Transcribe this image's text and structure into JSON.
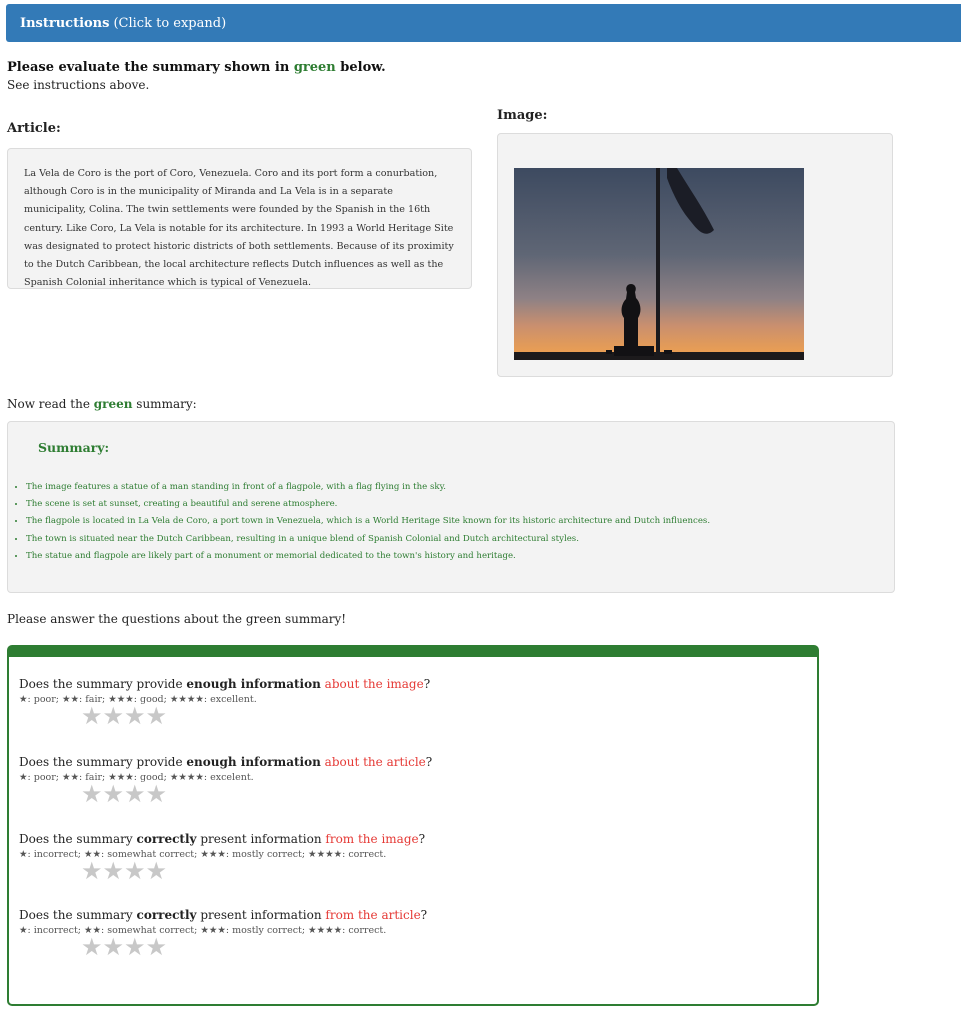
{
  "instructions_bar": {
    "title": "Instructions",
    "hint": "(Click to expand)"
  },
  "heading": {
    "prefix": "Please evaluate the summary shown in ",
    "green_word": "green",
    "suffix": " below."
  },
  "subheading": "See instructions above.",
  "article": {
    "label": "Article:",
    "text": "La Vela de Coro is the port of Coro, Venezuela. Coro and its port form a conurbation, although Coro is in the municipality of Miranda and La Vela is in a separate municipality, Colina. The twin settlements were founded by the Spanish in the 16th century. Like Coro, La Vela is notable for its architecture. In 1993 a World Heritage Site was designated to protect historic districts of both settlements. Because of its proximity to the Dutch Caribbean, the local architecture reflects Dutch influences as well as the Spanish Colonial inheritance which is typical of Venezuela."
  },
  "image_panel": {
    "label": "Image:"
  },
  "read_line": {
    "prefix": "Now read the ",
    "green_word": "green",
    "suffix": " summary:"
  },
  "summary": {
    "title": "Summary:",
    "items": [
      "The image features a statue of a man standing in front of a flagpole, with a flag flying in the sky.",
      "The scene is set at sunset, creating a beautiful and serene atmosphere.",
      "The flagpole is located in La Vela de Coro, a port town in Venezuela, which is a World Heritage Site known for its historic architecture and Dutch influences.",
      "The town is situated near the Dutch Caribbean, resulting in a unique blend of Spanish Colonial and Dutch architectural styles.",
      "The statue and flagpole are likely part of a monument or memorial dedicated to the town's history and heritage."
    ]
  },
  "answer_prompt": "Please answer the questions about the green summary!",
  "questions": [
    {
      "pre": "Does the summary provide ",
      "bold": "enough information",
      "mid": " ",
      "red": "about the image",
      "post": "?",
      "scale": "★: poor; ★★: fair; ★★★: good; ★★★★: excellent.",
      "star_count": 4
    },
    {
      "pre": "Does the summary provide ",
      "bold": "enough information",
      "mid": " ",
      "red": "about the article",
      "post": "?",
      "scale": "★: poor; ★★: fair; ★★★: good; ★★★★: excelent.",
      "star_count": 4
    },
    {
      "pre": "Does the summary ",
      "bold": "correctly",
      "mid": " present information ",
      "red": "from the image",
      "post": "?",
      "scale": "★: incorrect; ★★: somewhat correct; ★★★: mostly correct; ★★★★: correct.",
      "star_count": 4
    },
    {
      "pre": "Does the summary ",
      "bold": "correctly",
      "mid": " present information ",
      "red": "from the article",
      "post": "?",
      "scale": "★: incorrect; ★★: somewhat correct; ★★★: mostly correct; ★★★★: correct.",
      "star_count": 4
    }
  ],
  "colors": {
    "instructions_bar": "#337ab7",
    "summary_green": "#2e7d32",
    "highlight_red": "#e53935",
    "star_empty": "#c8c8c8"
  }
}
